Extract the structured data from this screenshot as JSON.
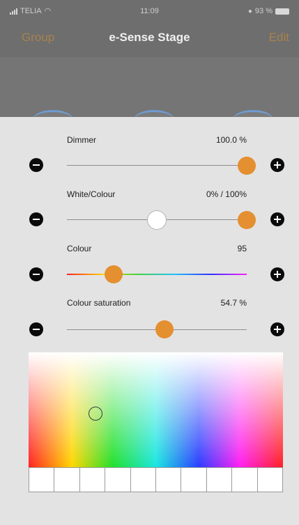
{
  "status_bar": {
    "carrier": "TELIA",
    "time": "11:09",
    "battery": "93 %"
  },
  "nav": {
    "left_label": "Group",
    "title": "e-Sense Stage",
    "right_label": "Edit"
  },
  "sliders": [
    {
      "label": "Dimmer",
      "value": "100.0 %",
      "level": 1.0
    },
    {
      "label": "White/Colour",
      "value": "0% / 100%",
      "level_low": 0.5,
      "level_high": 1.0
    },
    {
      "label": "Colour",
      "value": "95",
      "level": 0.26
    },
    {
      "label": "Colour saturation",
      "value": "54.7 %",
      "level": 0.547
    }
  ],
  "colors": {
    "accent": "#e48f30",
    "header_text_accent": "#a8824c"
  }
}
